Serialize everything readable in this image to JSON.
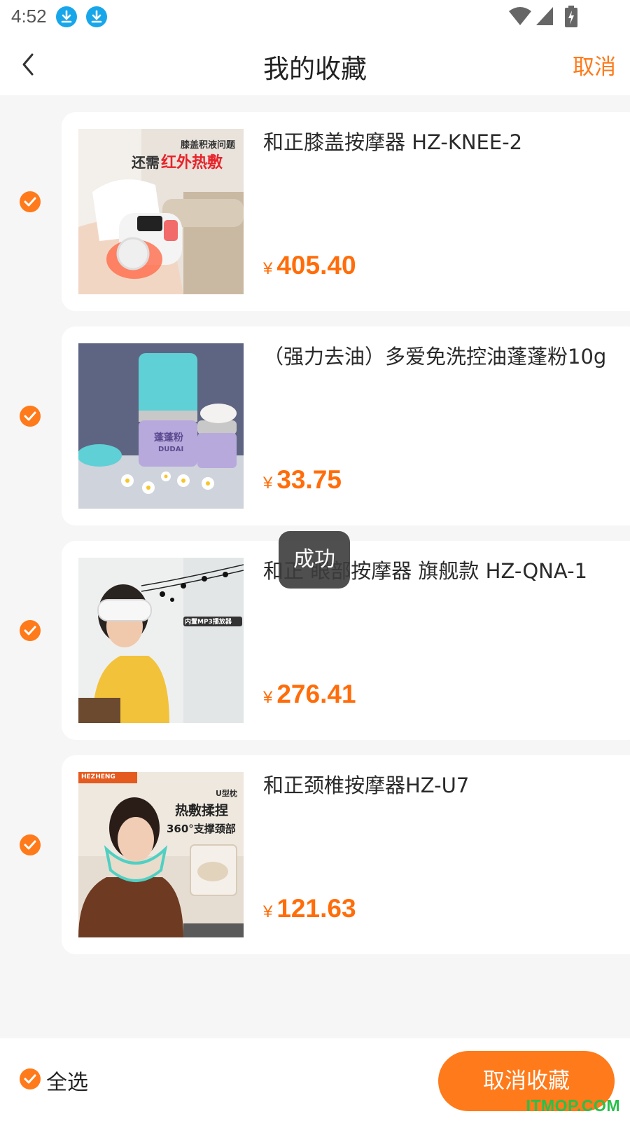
{
  "status_bar": {
    "time": "4:52"
  },
  "header": {
    "title": "我的收藏",
    "cancel_label": "取消"
  },
  "items": [
    {
      "title": "和正膝盖按摩器 HZ-KNEE-2",
      "currency": "¥",
      "price": "405.40",
      "image_texts": [
        "膝盖积液问题",
        "还需",
        "红外热敷"
      ]
    },
    {
      "title": "（强力去油）多爱免洗控油蓬蓬粉10g",
      "currency": "¥",
      "price": "33.75",
      "image_texts": [
        "蓬蓬粉",
        "DUDAI"
      ]
    },
    {
      "title": "和正 眼部按摩器 旗舰款 HZ-QNA-1",
      "currency": "¥",
      "price": "276.41",
      "image_texts": [
        "内置MP3播放器"
      ]
    },
    {
      "title": "和正颈椎按摩器HZ-U7",
      "currency": "¥",
      "price": "121.63",
      "image_texts": [
        "HEZHENG",
        "U型枕",
        "热敷揉捏",
        "360°支撑颈部"
      ]
    }
  ],
  "toast": "成功",
  "bottom_bar": {
    "select_all_label": "全选",
    "uncollect_label": "取消收藏"
  },
  "watermark": "ITMOP.COM",
  "colors": {
    "accent": "#ff7a1a",
    "price": "#ff6d0a",
    "background": "#f6f6f6"
  }
}
